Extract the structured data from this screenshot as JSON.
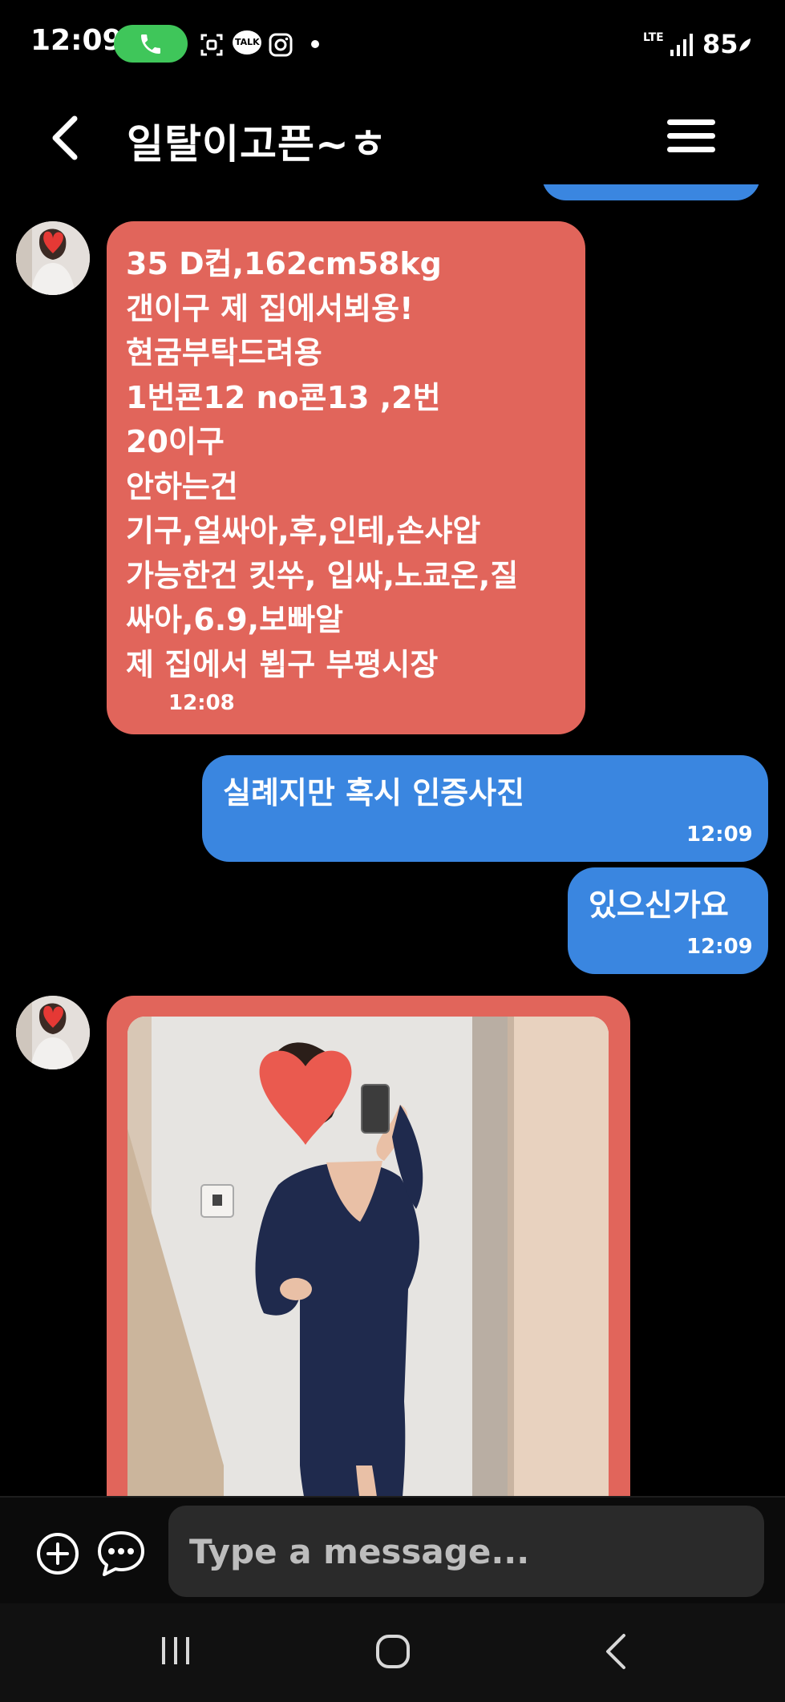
{
  "status_bar": {
    "time": "12:09",
    "network": "LTE",
    "battery": "85",
    "icons": [
      "call-icon",
      "screenshot-icon",
      "kakaotalk-icon",
      "instagram-icon",
      "dot-icon",
      "signal-icon",
      "battery-leaf-icon"
    ],
    "kakao_label": "TALK"
  },
  "header": {
    "title": "일탈이고픈~ㅎ",
    "back_icon": "chevron-left-icon",
    "menu_icon": "hamburger-menu-icon"
  },
  "messages": [
    {
      "direction": "incoming",
      "lines": [
        "35 D컵,162cm58kg",
        "갠이구 제 집에서뵈용!",
        "현굼부탁드려용",
        "1번쿈12 no쿈13 ,2번",
        "20이구",
        "안하는건",
        "기구,얼싸아,후,인테,손샤압",
        "가능한건 킷쑤, 입싸,노쿄온,질",
        "싸아,6.9,보빠알",
        "제 집에서 뵙구 부평시장"
      ],
      "time": "12:08"
    },
    {
      "direction": "outgoing",
      "text": "실례지만 혹시 인증사진",
      "time": "12:09"
    },
    {
      "direction": "outgoing",
      "text": "있으신가요",
      "time": "12:09"
    },
    {
      "direction": "incoming",
      "type": "photo"
    }
  ],
  "composer": {
    "placeholder": "Type a message...",
    "add_icon": "plus-circle-icon",
    "chat_icon": "chat-bubble-icon"
  },
  "navbar": {
    "icons": [
      "recent-apps-icon",
      "home-icon",
      "back-icon"
    ]
  },
  "colors": {
    "incoming_bubble": "#e1655b",
    "outgoing_bubble": "#3a86e0",
    "call_pill": "#3fc65a",
    "background": "#000000"
  }
}
